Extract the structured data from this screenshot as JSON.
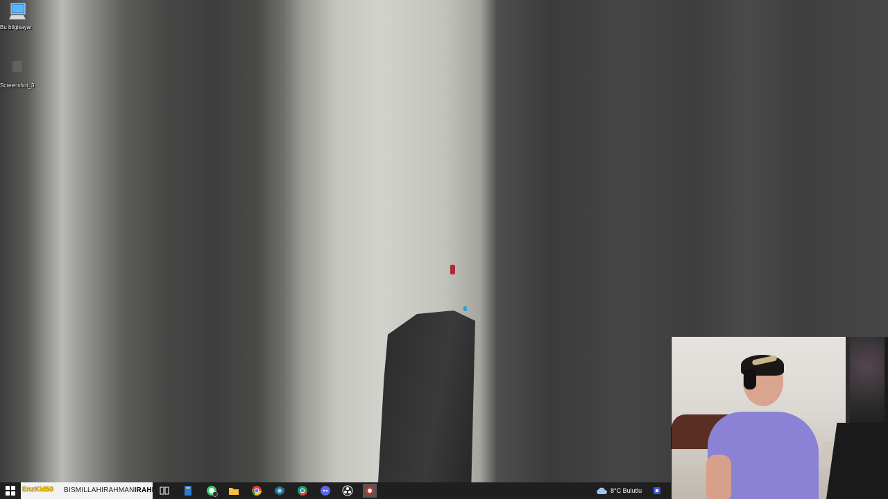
{
  "desktop": {
    "icons": [
      {
        "label": "Bu bilgisayar",
        "icon": "computer-icon"
      },
      {
        "label": "Screenshot_3",
        "icon": "image-file-icon"
      }
    ]
  },
  "taskbar": {
    "search_overlay": "EnzKid50",
    "search_text_prefix": "BISMILLAHIRAHMAN",
    "search_text_suffix": "IRAHIM",
    "pinned": [
      {
        "name": "task-view-icon"
      },
      {
        "name": "file-manager-icon"
      },
      {
        "name": "whatsapp-icon",
        "badge": "1"
      },
      {
        "name": "folder-icon"
      },
      {
        "name": "chrome-icon"
      },
      {
        "name": "app-cube-icon"
      },
      {
        "name": "chrome-alt-icon"
      },
      {
        "name": "discord-icon"
      },
      {
        "name": "obs-icon"
      },
      {
        "name": "record-icon"
      }
    ],
    "weather": {
      "icon": "cloud-icon",
      "text": "8°C  Bulutlu"
    }
  },
  "webcam": {
    "description_icon": "webcam-feed"
  },
  "colors": {
    "taskbar_bg": "#1f1f1f",
    "search_bg": "#f2f2f2",
    "overlay_text": "#e8b800"
  }
}
